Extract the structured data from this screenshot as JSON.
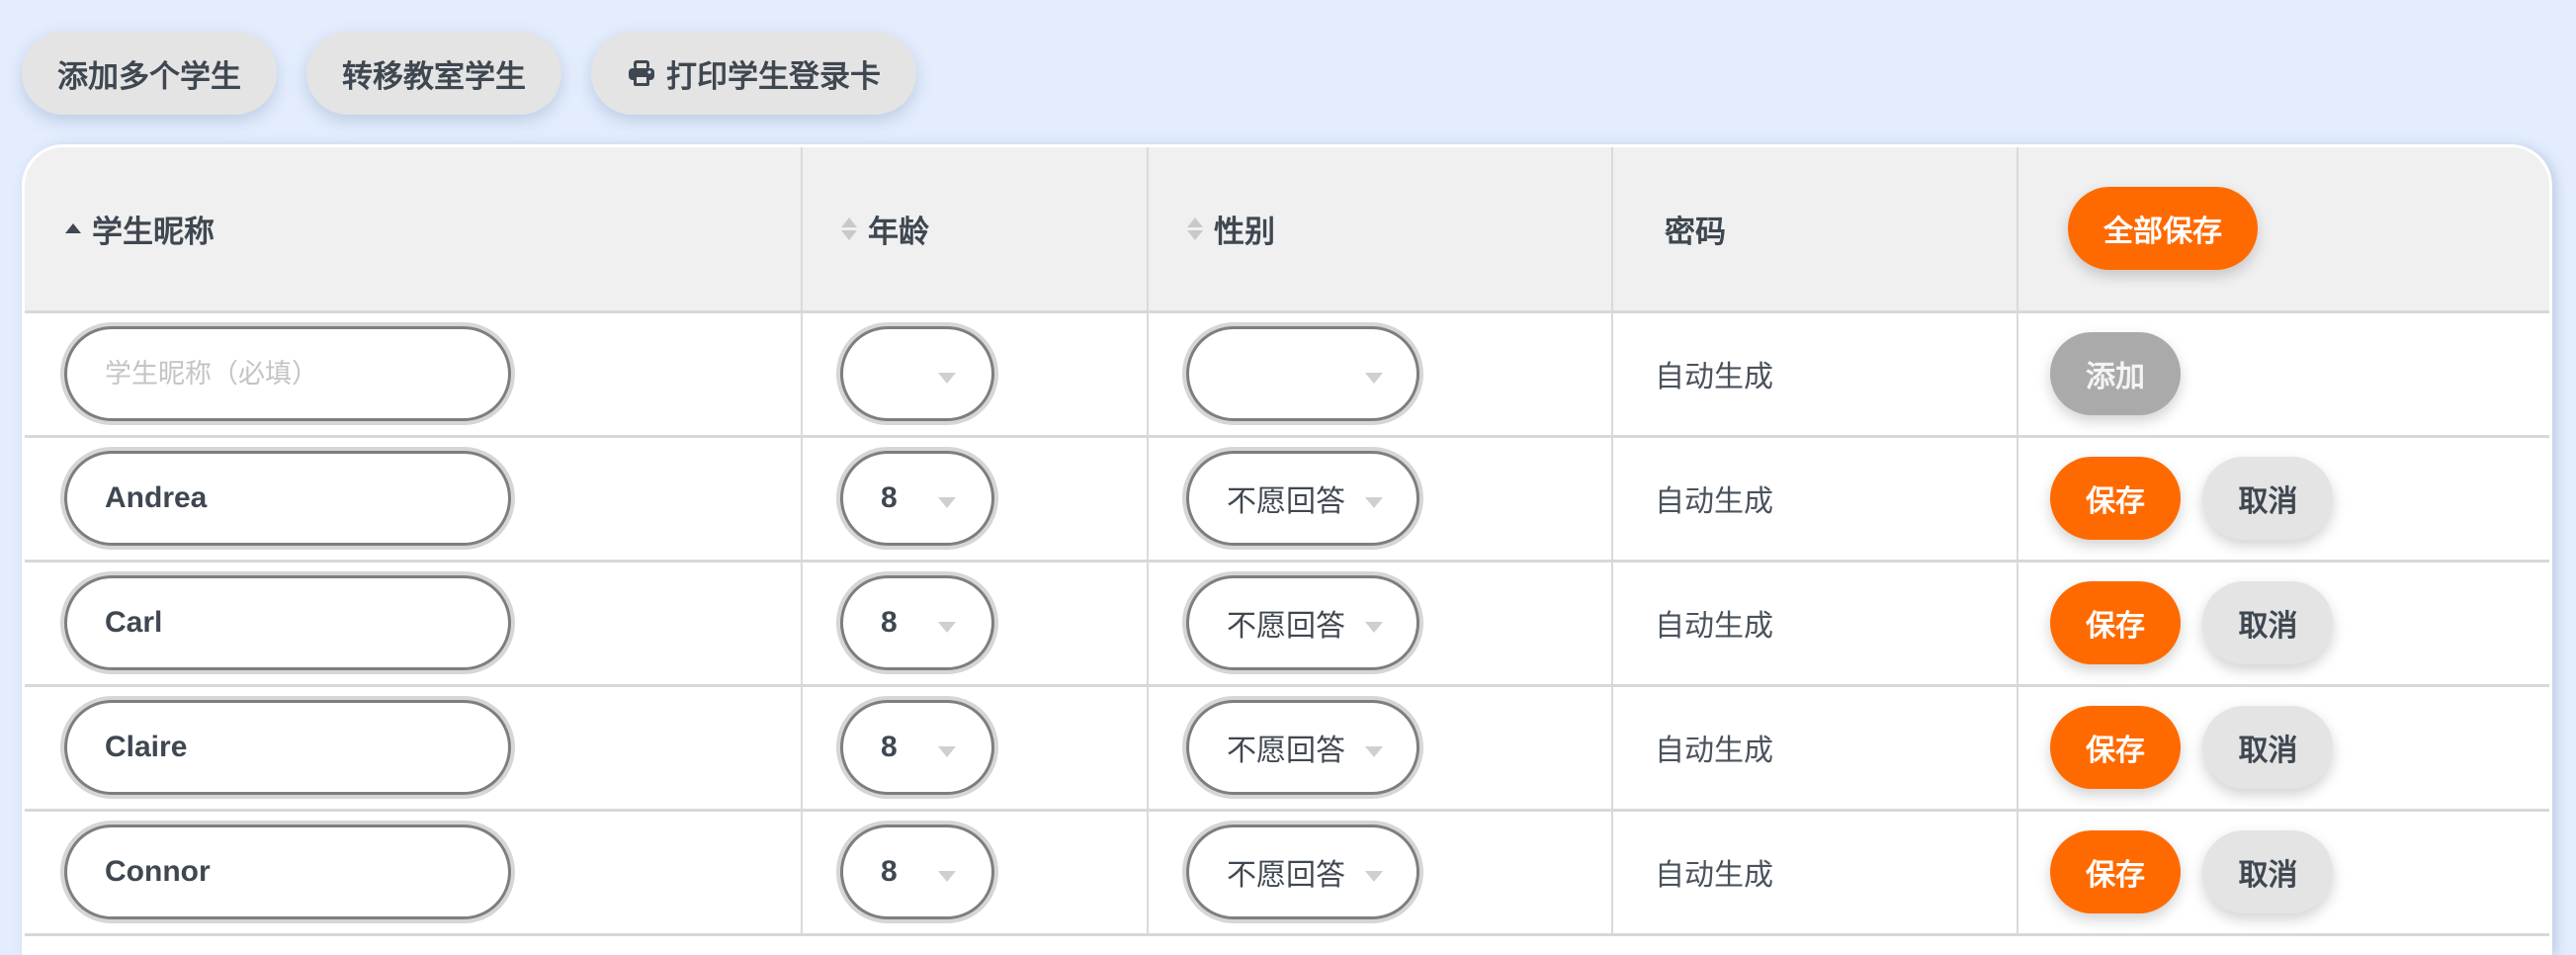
{
  "toolbar": {
    "add_multiple_label": "添加多个学生",
    "transfer_label": "转移教室学生",
    "print_label": "打印学生登录卡",
    "print_icon": "printer-icon"
  },
  "table": {
    "headers": {
      "nickname": "学生昵称",
      "age": "年龄",
      "gender": "性别",
      "password": "密码",
      "save_all": "全部保存"
    },
    "sort": {
      "column": "nickname",
      "direction": "asc"
    },
    "new_row": {
      "nickname_placeholder": "学生昵称（必填）",
      "nickname_value": "",
      "age": "",
      "gender": "",
      "password": "自动生成",
      "add_label": "添加"
    },
    "rows": [
      {
        "nickname": "Andrea",
        "age": "8",
        "gender": "不愿回答",
        "password": "自动生成",
        "save_label": "保存",
        "cancel_label": "取消"
      },
      {
        "nickname": "Carl",
        "age": "8",
        "gender": "不愿回答",
        "password": "自动生成",
        "save_label": "保存",
        "cancel_label": "取消"
      },
      {
        "nickname": "Claire",
        "age": "8",
        "gender": "不愿回答",
        "password": "自动生成",
        "save_label": "保存",
        "cancel_label": "取消"
      },
      {
        "nickname": "Connor",
        "age": "8",
        "gender": "不愿回答",
        "password": "自动生成",
        "save_label": "保存",
        "cancel_label": "取消"
      }
    ]
  },
  "colors": {
    "background": "#e3edfd",
    "accent": "#ff6a00",
    "neutral_button": "#e4e4e4",
    "disabled_button": "#aaaaaa",
    "text": "#3f4751"
  }
}
